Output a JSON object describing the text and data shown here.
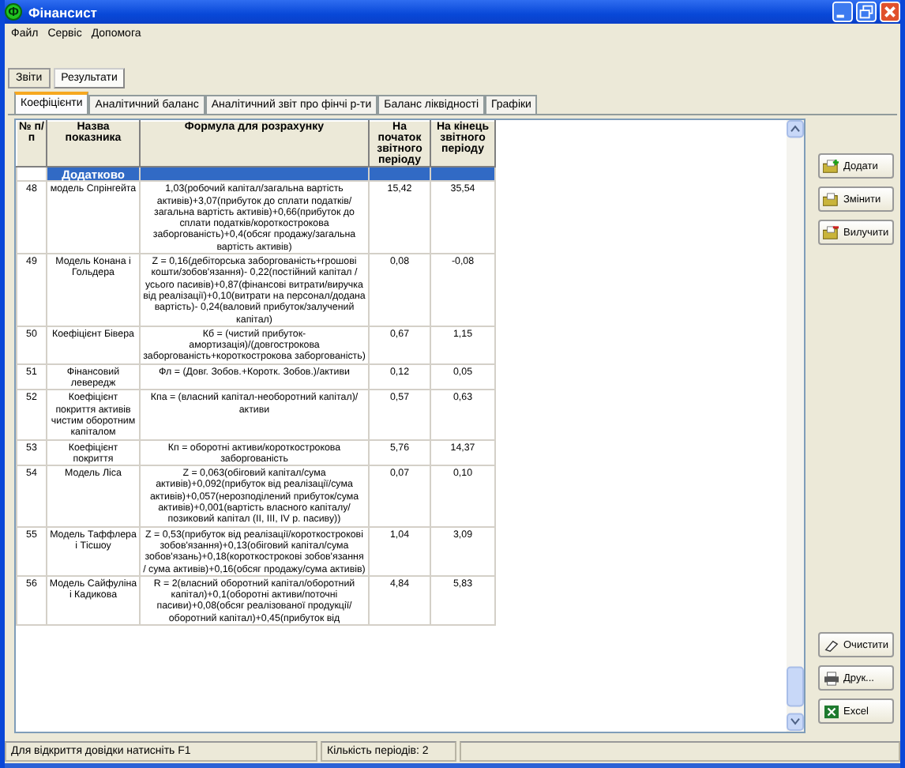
{
  "window": {
    "title": "Фінансист",
    "icon_glyph": "Ф"
  },
  "menu": [
    "Файл",
    "Сервіс",
    "Допомога"
  ],
  "outer_tabs": [
    {
      "label": "Звіти",
      "selected": false
    },
    {
      "label": "Результати",
      "selected": true
    }
  ],
  "inner_tabs": [
    {
      "label": "Коефіцієнти",
      "selected": true
    },
    {
      "label": "Аналітичний баланс",
      "selected": false
    },
    {
      "label": "Аналітичний звіт про фінчі р-ти",
      "selected": false
    },
    {
      "label": "Баланс ліквідності",
      "selected": false
    },
    {
      "label": "Графіки",
      "selected": false
    }
  ],
  "table": {
    "columns": [
      "№ п/п",
      "Назва показника",
      "Формула для розрахунку",
      "На початок звітного періоду",
      "На кінець звітного періоду"
    ],
    "group": "Додатково",
    "rows": [
      {
        "no": "48",
        "name": "модель Спрінгейта",
        "formula": "1,03(робочий капітал/загальна вартість активів)+3,07(прибуток до сплати податків/загальна вартість активів)+0,66(прибуток до сплати податків/короткострокова заборгованість)+0,4(обсяг продажу/загальна вартість активів)",
        "start": "15,42",
        "end": "35,54"
      },
      {
        "no": "49",
        "name": "Модель Конана і Гольдера",
        "formula": "Z = 0,16(дебіторська заборгованість+грошові кошти/зобов'язання)- 0,22(постійний капітал / усього пасивів)+0,87(фінансові витрати/виручка від реалізації)+0,10(витрати на персонал/додана вартість)- 0,24(валовий прибуток/залучений капітал)",
        "start": "0,08",
        "end": "-0,08"
      },
      {
        "no": "50",
        "name": "Коефіцієнт Бівера",
        "formula": "Кб = (чистий прибуток-амортизація)/(довгострокова заборгованість+короткострокова заборгованість)",
        "start": "0,67",
        "end": "1,15"
      },
      {
        "no": "51",
        "name": "Фінансовий левередж",
        "formula": "Фл = (Довг. Зобов.+Коротк. Зобов.)/активи",
        "start": "0,12",
        "end": "0,05"
      },
      {
        "no": "52",
        "name": "Коефіцієнт покриття активів чистим оборотним капіталом",
        "formula": "Кпа = (власний капітал-необоротний капітал)/активи",
        "start": "0,57",
        "end": "0,63"
      },
      {
        "no": "53",
        "name": "Коефіцієнт покриття",
        "formula": "Кп = оборотні активи/короткострокова заборгованість",
        "start": "5,76",
        "end": "14,37"
      },
      {
        "no": "54",
        "name": "Модель Ліса",
        "formula": "Z = 0,063(обіговий капітал/сума активів)+0,092(прибуток від реалізації/сума активів)+0,057(нерозподілений прибуток/сума активів)+0,001(вартість власного капіталу/позиковий капітал (ІІ, ІІІ, IV р. пасиву))",
        "start": "0,07",
        "end": "0,10"
      },
      {
        "no": "55",
        "name": "Модель Таффлера і Тісшоу",
        "formula": "Z = 0,53(прибуток від реалізації/короткострокові зобов'язання)+0,13(обіговий капітал/сума зобов'язань)+0,18(короткострокові зобов'язання / сума активів)+0,16(обсяг продажу/сума активів)",
        "start": "1,04",
        "end": "3,09"
      },
      {
        "no": "56",
        "name": "Модель Сайфуліна і Кадикова",
        "formula": "R = 2(власний оборотний капітал/оборотний капітал)+0,1(оборотні активи/поточні пасиви)+0,08(обсяг реалізованої продукції/оборотний капітал)+0,45(прибуток від",
        "start": "4,84",
        "end": "5,83"
      }
    ]
  },
  "side_buttons": [
    {
      "label": "Додати",
      "kind": "add"
    },
    {
      "label": "Змінити",
      "kind": "edit"
    },
    {
      "label": "Вилучити",
      "kind": "remove"
    },
    {
      "label": "Очистити",
      "kind": "clear"
    },
    {
      "label": "Друк...",
      "kind": "print"
    },
    {
      "label": "Excel",
      "kind": "excel"
    }
  ],
  "status_bar": [
    "Для відкриття довідки натисніть F1",
    "Кількість періодів: 2"
  ]
}
